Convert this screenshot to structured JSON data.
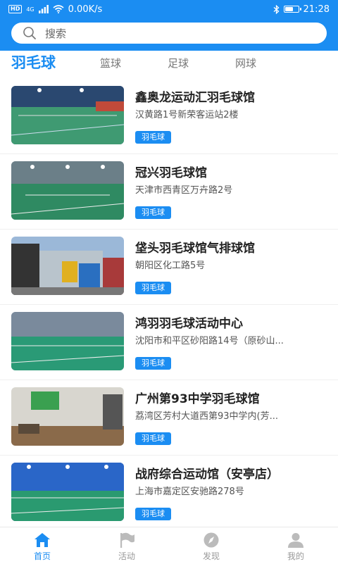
{
  "status": {
    "speed": "0.00K/s",
    "time": "21:28",
    "hd": "HD",
    "signal": "4G",
    "battery_level": 0.7
  },
  "search": {
    "placeholder": "搜索"
  },
  "tabs": [
    {
      "label": "羽毛球",
      "active": true
    },
    {
      "label": "篮球",
      "active": false
    },
    {
      "label": "足球",
      "active": false
    },
    {
      "label": "网球",
      "active": false
    }
  ],
  "venues": [
    {
      "name": "鑫奥龙运动汇羽毛球馆",
      "address": "汉黄路1号新荣客运站2楼",
      "tag": "羽毛球"
    },
    {
      "name": "冠兴羽毛球馆",
      "address": "天津市西青区万卉路2号",
      "tag": "羽毛球"
    },
    {
      "name": "垡头羽毛球馆气排球馆",
      "address": "朝阳区化工路5号",
      "tag": "羽毛球"
    },
    {
      "name": "鸿羽羽毛球活动中心",
      "address": "沈阳市和平区砂阳路14号（原砂山...",
      "tag": "羽毛球"
    },
    {
      "name": "广州第93中学羽毛球馆",
      "address": "荔湾区芳村大道西第93中学内(芳...",
      "tag": "羽毛球"
    },
    {
      "name": "战府综合运动馆（安亭店）",
      "address": "上海市嘉定区安驰路278号",
      "tag": "羽毛球"
    }
  ],
  "nav": [
    {
      "label": "首页",
      "icon": "home-icon",
      "active": true
    },
    {
      "label": "活动",
      "icon": "flag-icon",
      "active": false
    },
    {
      "label": "发现",
      "icon": "compass-icon",
      "active": false
    },
    {
      "label": "我的",
      "icon": "user-icon",
      "active": false
    }
  ],
  "colors": {
    "accent": "#1b8df2",
    "inactive": "#bbbbbb"
  }
}
